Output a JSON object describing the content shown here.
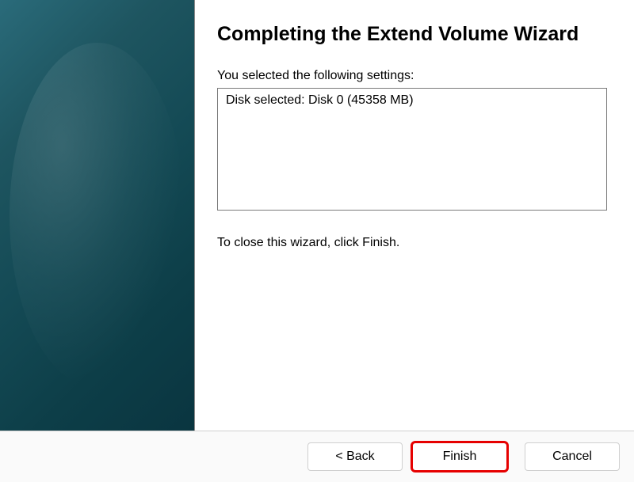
{
  "wizard": {
    "title": "Completing the Extend Volume Wizard",
    "settings_label": "You selected the following settings:",
    "settings_content": "Disk selected: Disk 0 (45358 MB)",
    "close_instruction": "To close this wizard, click Finish."
  },
  "buttons": {
    "back_label": "< Back",
    "finish_label": "Finish",
    "cancel_label": "Cancel"
  }
}
